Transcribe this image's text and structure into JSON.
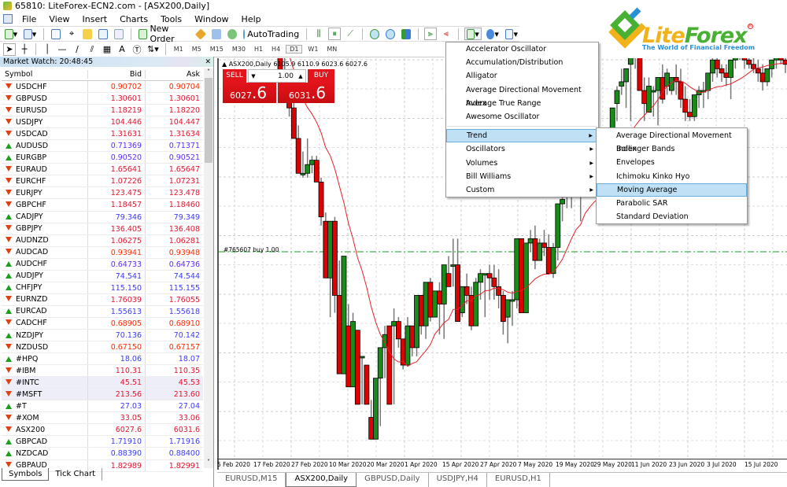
{
  "window": {
    "title": "65810: LiteForex-ECN2.com - [ASX200,Daily]"
  },
  "menubar": [
    "File",
    "View",
    "Insert",
    "Charts",
    "Tools",
    "Window",
    "Help"
  ],
  "toolbar": {
    "new_order_label": "New Order",
    "autotrading_label": "AutoTrading",
    "timeframes": [
      "M1",
      "M5",
      "M15",
      "M30",
      "H1",
      "H4",
      "D1",
      "W1",
      "MN"
    ],
    "active_timeframe": "D1",
    "text_tool_label": "A"
  },
  "market_watch": {
    "title": "Market Watch: 20:48:45",
    "columns": [
      "Symbol",
      "Bid",
      "Ask"
    ],
    "rows": [
      {
        "symbol": "USDCHF",
        "bid": "0.90702",
        "ask": "0.90704",
        "dir": "down",
        "color": "#ff2a00"
      },
      {
        "symbol": "GBPUSD",
        "bid": "1.30601",
        "ask": "1.30601",
        "dir": "down",
        "color": "#e8122c"
      },
      {
        "symbol": "EURUSD",
        "bid": "1.18219",
        "ask": "1.18220",
        "dir": "down",
        "color": "#e8122c"
      },
      {
        "symbol": "USDJPY",
        "bid": "104.446",
        "ask": "104.447",
        "dir": "down",
        "color": "#e8122c"
      },
      {
        "symbol": "USDCAD",
        "bid": "1.31631",
        "ask": "1.31634",
        "dir": "down",
        "color": "#e8122c"
      },
      {
        "symbol": "AUDUSD",
        "bid": "0.71369",
        "ask": "0.71371",
        "dir": "up",
        "color": "#5a2cff"
      },
      {
        "symbol": "EURGBP",
        "bid": "0.90520",
        "ask": "0.90521",
        "dir": "up",
        "color": "#5a2cff"
      },
      {
        "symbol": "EURAUD",
        "bid": "1.65641",
        "ask": "1.65647",
        "dir": "down",
        "color": "#e8122c"
      },
      {
        "symbol": "EURCHF",
        "bid": "1.07226",
        "ask": "1.07231",
        "dir": "down",
        "color": "#e8122c"
      },
      {
        "symbol": "EURJPY",
        "bid": "123.475",
        "ask": "123.478",
        "dir": "down",
        "color": "#e8122c"
      },
      {
        "symbol": "GBPCHF",
        "bid": "1.18457",
        "ask": "1.18460",
        "dir": "down",
        "color": "#e8122c"
      },
      {
        "symbol": "CADJPY",
        "bid": "79.346",
        "ask": "79.349",
        "dir": "up",
        "color": "#3a3aff"
      },
      {
        "symbol": "GBPJPY",
        "bid": "136.405",
        "ask": "136.408",
        "dir": "down",
        "color": "#e8122c"
      },
      {
        "symbol": "AUDNZD",
        "bid": "1.06275",
        "ask": "1.06281",
        "dir": "down",
        "color": "#e8122c"
      },
      {
        "symbol": "AUDCAD",
        "bid": "0.93941",
        "ask": "0.93948",
        "dir": "down",
        "color": "#ff2a00"
      },
      {
        "symbol": "AUDCHF",
        "bid": "0.64733",
        "ask": "0.64736",
        "dir": "up",
        "color": "#5a2cff"
      },
      {
        "symbol": "AUDJPY",
        "bid": "74.541",
        "ask": "74.544",
        "dir": "up",
        "color": "#3a3aff"
      },
      {
        "symbol": "CHFJPY",
        "bid": "115.150",
        "ask": "115.155",
        "dir": "up",
        "color": "#3a3aff"
      },
      {
        "symbol": "EURNZD",
        "bid": "1.76039",
        "ask": "1.76055",
        "dir": "down",
        "color": "#e8122c"
      },
      {
        "symbol": "EURCAD",
        "bid": "1.55613",
        "ask": "1.55618",
        "dir": "up",
        "color": "#3a3aff"
      },
      {
        "symbol": "CADCHF",
        "bid": "0.68905",
        "ask": "0.68910",
        "dir": "down",
        "color": "#ff2a00"
      },
      {
        "symbol": "NZDJPY",
        "bid": "70.136",
        "ask": "70.142",
        "dir": "up",
        "color": "#3a3aff"
      },
      {
        "symbol": "NZDUSD",
        "bid": "0.67150",
        "ask": "0.67157",
        "dir": "down",
        "color": "#ff2a00"
      },
      {
        "symbol": "#HPQ",
        "bid": "18.06",
        "ask": "18.07",
        "dir": "up",
        "color": "#3a3aff"
      },
      {
        "symbol": "#IBM",
        "bid": "110.31",
        "ask": "110.35",
        "dir": "down",
        "color": "#e8122c"
      },
      {
        "symbol": "#INTC",
        "bid": "45.51",
        "ask": "45.53",
        "dir": "down",
        "color": "#e8122c",
        "highlight": true
      },
      {
        "symbol": "#MSFT",
        "bid": "213.56",
        "ask": "213.60",
        "dir": "down",
        "color": "#e8122c",
        "highlight": true
      },
      {
        "symbol": "#T",
        "bid": "27.03",
        "ask": "27.04",
        "dir": "up",
        "color": "#3a3aff"
      },
      {
        "symbol": "#XOM",
        "bid": "33.05",
        "ask": "33.06",
        "dir": "down",
        "color": "#e8122c"
      },
      {
        "symbol": "ASX200",
        "bid": "6027.6",
        "ask": "6031.6",
        "dir": "down",
        "color": "#e8122c"
      },
      {
        "symbol": "GBPCAD",
        "bid": "1.71910",
        "ask": "1.71916",
        "dir": "up",
        "color": "#3a3aff"
      },
      {
        "symbol": "NZDCAD",
        "bid": "0.88390",
        "ask": "0.88400",
        "dir": "up",
        "color": "#3a3aff"
      },
      {
        "symbol": "GBPAUD",
        "bid": "1.82989",
        "ask": "1.82991",
        "dir": "down",
        "color": "#e8122c"
      }
    ],
    "tabs": [
      "Symbols",
      "Tick Chart"
    ],
    "active_tab": "Symbols"
  },
  "chart": {
    "info": "▲ ASX200,Daily  6105.9 6110.9 6023.6 6027.6",
    "one_click": {
      "sell_label": "SELL",
      "buy_label": "BUY",
      "lot": "1.00",
      "sell_price_main": "6027",
      "sell_price_big": ".6",
      "buy_price_main": "6031",
      "buy_price_big": ".6"
    },
    "trade_line_label": "#765607 buy 1.00",
    "date_labels": [
      "5 Feb 2020",
      "17 Feb 2020",
      "27 Feb 2020",
      "10 Mar 2020",
      "20 Mar 2020",
      "1 Apr 2020",
      "15 Apr 2020",
      "27 Apr 2020",
      "7 May 2020",
      "19 May 2020",
      "29 May 2020",
      "11 Jun 2020",
      "23 Jun 2020",
      "3 Jul 2020",
      "15 Jul 2020"
    ],
    "tabs": [
      "EURUSD,M15",
      "ASX200,Daily",
      "GBPUSD,Daily",
      "USDJPY,H4",
      "EURUSD,H1"
    ],
    "active_tab": "ASX200,Daily",
    "colors": {
      "bull": "#1a8a1a",
      "bear": "#e00000",
      "ma": "#e8202a",
      "trade_line": "#1a9a1a"
    }
  },
  "chart_data": {
    "type": "candlestick",
    "title": "ASX200,Daily",
    "indicator": "Moving Average",
    "xlabel": "",
    "ylabel": "",
    "ylim_relative": "price rises upward; scale not labeled",
    "candles": [
      [
        100,
        120,
        96,
        82
      ],
      [
        82,
        90,
        80,
        70
      ],
      [
        70,
        76,
        62,
        66
      ],
      [
        66,
        72,
        60,
        52
      ],
      [
        52,
        58,
        40,
        36
      ],
      [
        36,
        46,
        34,
        36
      ],
      [
        36,
        52,
        34,
        40
      ],
      [
        40,
        44,
        36,
        42
      ],
      [
        42,
        44,
        32,
        32
      ],
      [
        32,
        34,
        12,
        16
      ],
      [
        14,
        18,
        -6,
        -12
      ],
      [
        -12,
        -12,
        -30,
        14
      ],
      [
        14,
        16,
        -28,
        -20
      ],
      [
        -20,
        -4,
        -52,
        -56
      ],
      [
        -56,
        -6,
        -56,
        -2
      ],
      [
        -34,
        -24,
        -54,
        -62
      ],
      [
        -62,
        -28,
        -62,
        -32
      ],
      [
        -36,
        -40,
        -70,
        -70
      ],
      [
        -48,
        -48,
        -70,
        -48
      ],
      [
        -52,
        -52,
        -70,
        -70
      ],
      [
        -76,
        -68,
        -78,
        -86
      ],
      [
        -86,
        -60,
        -86,
        -58
      ],
      [
        -58,
        -46,
        -80,
        -44
      ],
      [
        -44,
        -34,
        -58,
        -38
      ],
      [
        -34,
        -34,
        -70,
        -70
      ],
      [
        -34,
        -26,
        -70,
        -32
      ],
      [
        -32,
        -30,
        -44,
        -40
      ],
      [
        -40,
        -40,
        -54,
        -52
      ],
      [
        -52,
        -30,
        -52,
        -34
      ],
      [
        -34,
        -34,
        -48,
        -44
      ],
      [
        -44,
        -22,
        -48,
        -20
      ],
      [
        -20,
        -22,
        -38,
        -34
      ],
      [
        -34,
        -14,
        -40,
        -14
      ],
      [
        -14,
        -12,
        -32,
        -30
      ],
      [
        -30,
        -18,
        -30,
        -18
      ],
      [
        -18,
        -14,
        -38,
        -24
      ],
      [
        -24,
        -8,
        -40,
        -6
      ],
      [
        -10,
        -2,
        -14,
        -16
      ],
      [
        -6,
        6,
        -16,
        -6
      ],
      [
        -6,
        6,
        -22,
        -32
      ],
      [
        -28,
        -18,
        -30,
        -16
      ],
      [
        -16,
        -10,
        -24,
        -20
      ],
      [
        -20,
        -16,
        -36,
        -34
      ],
      [
        -34,
        -12,
        -34,
        -14
      ],
      [
        -14,
        -8,
        -22,
        -10
      ],
      [
        -10,
        -10,
        -30,
        -10
      ],
      [
        -10,
        -6,
        -22,
        -12
      ],
      [
        -12,
        -6,
        -22,
        -16
      ],
      [
        -16,
        -8,
        -26,
        -20
      ],
      [
        -20,
        -18,
        -38,
        -32
      ],
      [
        -30,
        -26,
        -42,
        -22
      ],
      [
        -22,
        -18,
        -34,
        -22
      ],
      [
        -22,
        2,
        -26,
        6
      ],
      [
        6,
        6,
        -26,
        -28
      ],
      [
        -28,
        4,
        -28,
        4
      ],
      [
        4,
        10,
        0,
        6
      ],
      [
        6,
        12,
        -8,
        -4
      ],
      [
        -4,
        6,
        -4,
        4
      ],
      [
        4,
        10,
        -2,
        2
      ],
      [
        2,
        8,
        -10,
        -10
      ],
      [
        -10,
        4,
        -12,
        2
      ],
      [
        2,
        20,
        -4,
        22
      ],
      [
        22,
        26,
        14,
        24
      ],
      [
        26,
        30,
        20,
        34
      ],
      [
        34,
        36,
        20,
        44
      ],
      [
        44,
        50,
        40,
        36
      ],
      [
        36,
        44,
        14,
        38
      ],
      [
        38,
        50,
        28,
        44
      ],
      [
        44,
        48,
        44,
        44
      ],
      [
        48,
        54,
        44,
        40
      ],
      [
        40,
        40,
        30,
        22
      ],
      [
        22,
        36,
        22,
        46
      ],
      [
        46,
        54,
        34,
        54
      ],
      [
        56,
        64,
        50,
        66
      ],
      [
        68,
        76,
        60,
        74
      ],
      [
        76,
        84,
        72,
        78
      ],
      [
        78,
        80,
        66,
        84
      ],
      [
        86,
        84,
        60,
        90
      ],
      [
        90,
        96,
        84,
        92
      ],
      [
        92,
        90,
        74,
        74
      ],
      [
        74,
        80,
        60,
        68
      ],
      [
        64,
        80,
        66,
        76
      ],
      [
        74,
        76,
        62,
        74
      ],
      [
        74,
        78,
        58,
        80
      ],
      [
        80,
        86,
        68,
        70
      ],
      [
        76,
        84,
        72,
        82
      ],
      [
        74,
        80,
        72,
        80
      ],
      [
        80,
        86,
        72,
        78
      ],
      [
        78,
        84,
        66,
        70
      ],
      [
        70,
        76,
        60,
        64
      ],
      [
        64,
        70,
        60,
        62
      ],
      [
        62,
        72,
        60,
        72
      ],
      [
        72,
        76,
        66,
        74
      ],
      [
        74,
        78,
        66,
        74
      ],
      [
        74,
        80,
        70,
        82
      ],
      [
        82,
        90,
        78,
        88
      ],
      [
        88,
        94,
        80,
        84
      ],
      [
        84,
        86,
        78,
        82
      ],
      [
        82,
        86,
        76,
        80
      ],
      [
        80,
        86,
        70,
        88
      ],
      [
        88,
        96,
        84,
        96
      ],
      [
        96,
        100,
        88,
        94
      ],
      [
        94,
        96,
        84,
        88
      ],
      [
        88,
        92,
        84,
        86
      ],
      [
        86,
        90,
        82,
        84
      ],
      [
        84,
        88,
        78,
        82
      ],
      [
        82,
        86,
        74,
        78
      ],
      [
        78,
        84,
        76,
        84
      ],
      [
        84,
        88,
        80,
        88
      ],
      [
        88,
        96,
        84,
        92
      ],
      [
        92,
        100,
        86,
        88
      ],
      [
        88,
        94,
        82,
        86
      ]
    ]
  },
  "indicators_menu": {
    "items": [
      "Accelerator Oscillator",
      "Accumulation/Distribution",
      "Alligator",
      "Average Directional Movement Index",
      "Average True Range",
      "Awesome Oscillator"
    ],
    "groups": [
      "Trend",
      "Oscillators",
      "Volumes",
      "Bill Williams",
      "Custom"
    ],
    "active_group": "Trend"
  },
  "trend_submenu": {
    "items": [
      "Average Directional Movement Index",
      "Bollinger Bands",
      "Envelopes",
      "Ichimoku Kinko Hyo",
      "Moving Average",
      "Parabolic SAR",
      "Standard Deviation"
    ],
    "highlighted": "Moving Average"
  },
  "logo": {
    "brand_lite": "Lite",
    "brand_forex": "Forex",
    "reg": "R",
    "tagline": "The World of Financial Freedom"
  }
}
